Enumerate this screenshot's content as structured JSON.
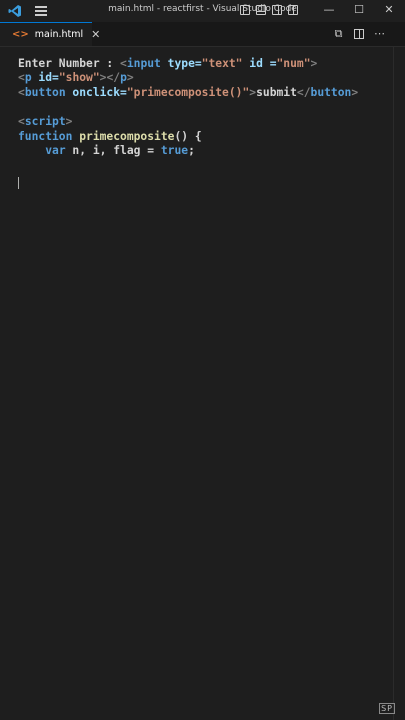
{
  "window": {
    "title": "main.html - reactfirst - Visual Studio Code",
    "controls": {
      "minimize": "—",
      "maximize": "☐",
      "close": "✕"
    }
  },
  "tabs": [
    {
      "icon": "<>",
      "label": "main.html",
      "close": "✕"
    }
  ],
  "editor": {
    "line1": {
      "text1": "Enter Number : ",
      "lt1": "<",
      "tag": "input",
      "attr1": " type=",
      "str1": "\"text\"",
      "attr2": " id =",
      "str2": "\"num\"",
      "gt": ">"
    },
    "line2": {
      "lt": "<",
      "tag": "p",
      "attr": " id=",
      "str": "\"show\"",
      "gt1": "></",
      "tag2": "p",
      "gt2": ">"
    },
    "line3": {
      "lt": "<",
      "tag": "button",
      "attr": " onclick=",
      "str": "\"primecomposite()\"",
      "gt1": ">",
      "text": "submit",
      "lt2": "</",
      "tag2": "button",
      "gt2": ">"
    },
    "line5": {
      "lt": "<",
      "tag": "script",
      "gt": ">"
    },
    "line6": {
      "kw": "function",
      "fn": " primecomposite",
      "rest": "() {"
    },
    "line7": {
      "indent": "    ",
      "kw": "var",
      "rest": " n, i, flag = ",
      "val": "true",
      "end": ";"
    }
  },
  "watermark": "SP"
}
